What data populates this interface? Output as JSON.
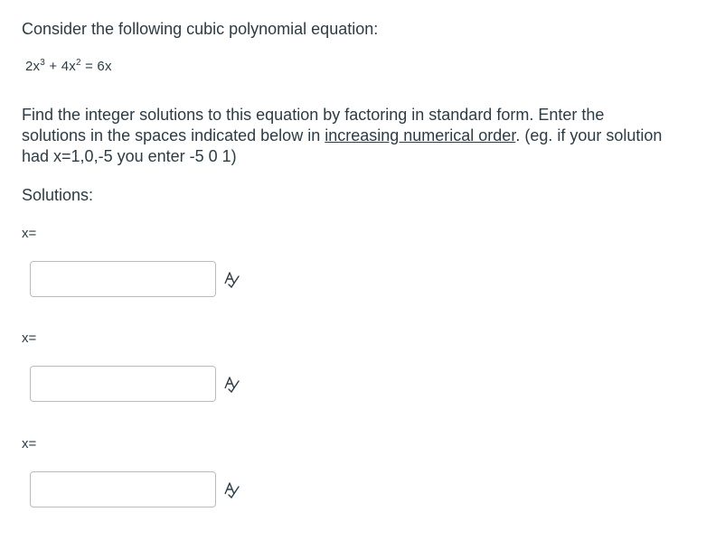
{
  "question": {
    "intro": "Consider the following cubic polynomial equation:",
    "equation": {
      "coef1": "2x",
      "exp1": "3",
      "mid": " + 4x",
      "exp2": "2",
      "rhs": " = 6x"
    },
    "prompt": {
      "part1": "Find the integer solutions to this equation by factoring in standard form.  Enter the solutions in the spaces indicated below in ",
      "underlined": "increasing numerical order",
      "part2": ". (eg. if your solution had x=1,0,-5 you enter -5  0  1)"
    },
    "solutions_label": "Solutions:"
  },
  "answers": [
    {
      "label": "x=",
      "value": "",
      "icon": "equation-preview-icon"
    },
    {
      "label": "x=",
      "value": "",
      "icon": "equation-preview-icon"
    },
    {
      "label": "x=",
      "value": "",
      "icon": "equation-preview-icon"
    }
  ]
}
